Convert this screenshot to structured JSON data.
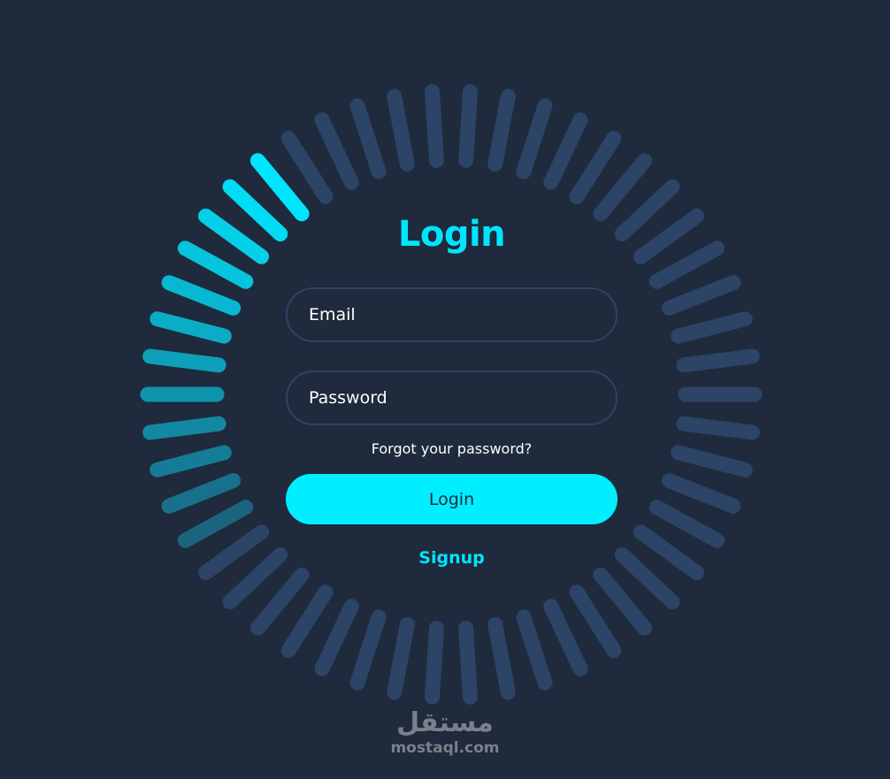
{
  "colors": {
    "background": "#1f2a3c",
    "accent": "#00e5ff",
    "ring_inactive": "#2c4466",
    "field_border": "#2c4466",
    "button_text": "#1f2a3c"
  },
  "login": {
    "title": "Login",
    "email_placeholder": "Email",
    "password_placeholder": "Password",
    "forgot_label": "Forgot your password?",
    "button_label": "Login",
    "signup_label": "Signup"
  },
  "ring": {
    "bar_count": 50
  },
  "watermark": {
    "arabic": "مستقل",
    "domain": "mostaql.com"
  }
}
